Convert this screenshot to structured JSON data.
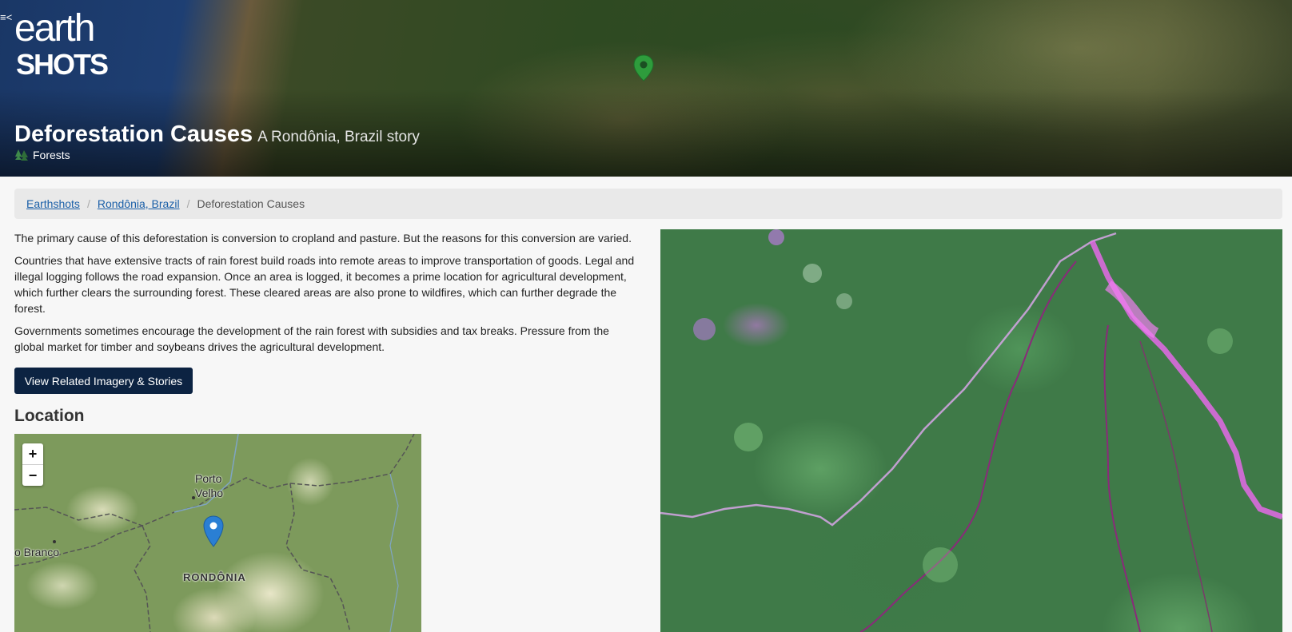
{
  "header": {
    "menu_glyph": "≡<",
    "logo_line1": "earth",
    "logo_line2": "SHOTS",
    "title": "Deforestation Causes",
    "subtitle": "A Rondônia, Brazil story",
    "category": "Forests",
    "category_icon": "tree-icon",
    "pin_color": "#2e9c3c"
  },
  "breadcrumb": {
    "items": [
      {
        "label": "Earthshots"
      },
      {
        "label": "Rondônia, Brazil"
      }
    ],
    "current": "Deforestation Causes",
    "separator": "/"
  },
  "content": {
    "paragraphs": [
      "The primary cause of this deforestation is conversion to cropland and pasture. But the reasons for this conversion are varied.",
      "Countries that have extensive tracts of rain forest build roads into remote areas to improve transportation of goods. Legal and illegal logging follows the road expansion. Once an area is logged, it becomes a prime location for agricultural development, which further clears the surrounding forest. These cleared areas are also prone to wildfires, which can further degrade the forest.",
      "Governments sometimes encourage the development of the rain forest with subsidies and tax breaks. Pressure from the global market for timber and soybeans drives the agricultural development."
    ],
    "button_label": "View Related Imagery & Stories",
    "location_heading": "Location"
  },
  "map": {
    "zoom_in": "+",
    "zoom_out": "−",
    "labels": {
      "porto_velho_1": "Porto",
      "porto_velho_2": "Velho",
      "rio_branco": "o Branco",
      "state": "RONDÔNIA"
    },
    "pin_color": "#2a7fd4"
  },
  "colors": {
    "button_bg": "#0c2342",
    "link": "#1a5fa8",
    "page_bg": "#f7f7f7"
  }
}
